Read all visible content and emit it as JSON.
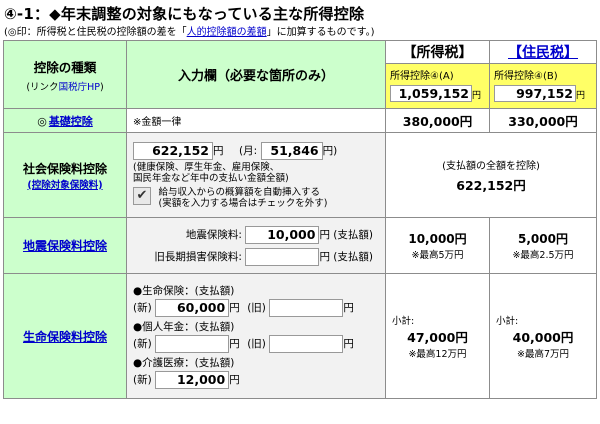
{
  "title": "④-1：◆年末調整の対象にもなっている主な所得控除",
  "note": {
    "before": "(◎印：所得税と住民税の控除額の差を「",
    "link": "人的控除額の差額",
    "after": "」に加算するものです。)"
  },
  "header": {
    "type_label": "控除の種類",
    "type_link_prefix": "(リンク",
    "type_link": "国税庁HP",
    "type_link_suffix": ")",
    "input_label": "入力欄（必要な箇所のみ）",
    "income_tax": "【所得税】",
    "resident_tax": "【住民税】",
    "income_total_label": "所得控除④(A)",
    "income_total_value": "1,059,152",
    "resident_total_label": "所得控除④(B)",
    "resident_total_value": "997,152",
    "yen": "円"
  },
  "basic": {
    "mark": "◎",
    "label": "基礎控除",
    "note": "※金額一律",
    "income": "380,000円",
    "resident": "330,000円"
  },
  "social": {
    "label": "社会保険料控除",
    "sublink": "(控除対象保険料)",
    "amount": "622,152",
    "yen": "円",
    "month_label": "(月:",
    "month_amount": "51,846",
    "month_yen": "円)",
    "desc1": "(健康保険、厚生年金、雇用保険、",
    "desc2": "国民年金など年中の支払い金額全額)",
    "check_mark": "✔",
    "auto1": "給与収入からの概算額を自動挿入する",
    "auto2": "(実額を入力する場合はチェックを外す)",
    "result_label": "(支払額の全額を控除)",
    "result_value": "622,152円"
  },
  "earthquake": {
    "label": "地震保険料控除",
    "row1_label": "地震保険料:",
    "row1_value": "10,000",
    "row1_suffix": "円 (支払額)",
    "row2_label": "旧長期損害保険料:",
    "row2_value": "",
    "row2_suffix": "円 (支払額)",
    "income": "10,000円",
    "income_note": "※最高5万円",
    "resident": "5,000円",
    "resident_note": "※最高2.5万円"
  },
  "life": {
    "label": "生命保険料控除",
    "sec1": "●生命保険：(支払額)",
    "sec2": "●個人年金：(支払額)",
    "sec3": "●介護医療：(支払額)",
    "new_label": "(新)",
    "old_label": "(旧)",
    "life_new": "60,000",
    "life_old": "",
    "pension_new": "",
    "pension_old": "",
    "care_new": "12,000",
    "yen": "円",
    "subtotal_label": "小計:",
    "income": "47,000円",
    "income_note": "※最高12万円",
    "resident": "40,000円",
    "resident_note": "※最高7万円"
  }
}
